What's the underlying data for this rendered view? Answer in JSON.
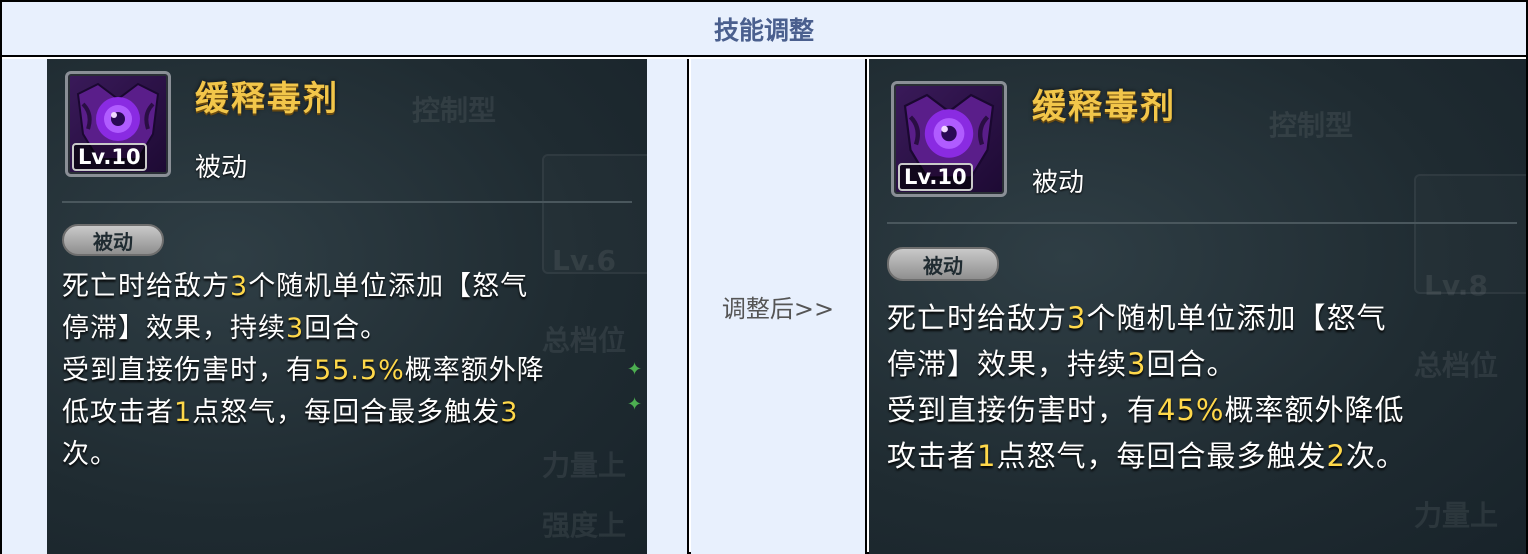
{
  "header": {
    "title": "技能调整"
  },
  "middle": {
    "label": "调整后>>"
  },
  "before": {
    "level": "Lv.10",
    "name": "缓释毒剂",
    "type": "被动",
    "badge": "被动",
    "lines": [
      [
        {
          "t": "死亡时给敌方"
        },
        {
          "t": "3",
          "hl": true
        },
        {
          "t": "个随机单位添加【怒气"
        }
      ],
      [
        {
          "t": "停滞】效果，持续"
        },
        {
          "t": "3",
          "hl": true
        },
        {
          "t": "回合。"
        }
      ],
      [
        {
          "t": "受到直接伤害时，有"
        },
        {
          "t": "55.5%",
          "hl": true
        },
        {
          "t": "概率额外降"
        }
      ],
      [
        {
          "t": "低攻击者"
        },
        {
          "t": "1",
          "hl": true
        },
        {
          "t": "点怒气，每回合最多触发"
        },
        {
          "t": "3",
          "hl": true
        }
      ],
      [
        {
          "t": "次。"
        }
      ]
    ],
    "ghost": [
      "控制型",
      "Lv.6",
      "总档位",
      "力量上",
      "强度上"
    ]
  },
  "after": {
    "level": "Lv.10",
    "name": "缓释毒剂",
    "type": "被动",
    "badge": "被动",
    "lines": [
      [
        {
          "t": "死亡时给敌方"
        },
        {
          "t": "3",
          "hl": true
        },
        {
          "t": "个随机单位添加【怒气"
        }
      ],
      [
        {
          "t": "停滞】效果，持续"
        },
        {
          "t": "3",
          "hl": true
        },
        {
          "t": "回合。"
        }
      ],
      [
        {
          "t": "受到直接伤害时，有"
        },
        {
          "t": "45%",
          "hl": true
        },
        {
          "t": "概率额外降低"
        }
      ],
      [
        {
          "t": "攻击者"
        },
        {
          "t": "1",
          "hl": true
        },
        {
          "t": "点怒气，每回合最多触发"
        },
        {
          "t": "2",
          "hl": true
        },
        {
          "t": "次。"
        }
      ]
    ],
    "ghost": [
      "控制型",
      "Lv.8",
      "总档位",
      "力量上"
    ]
  },
  "colors": {
    "highlight": "#ffd84a",
    "skill_name": "#f2c64a",
    "header_bg": "#e8f0fd",
    "header_text": "#4a5f8e"
  }
}
